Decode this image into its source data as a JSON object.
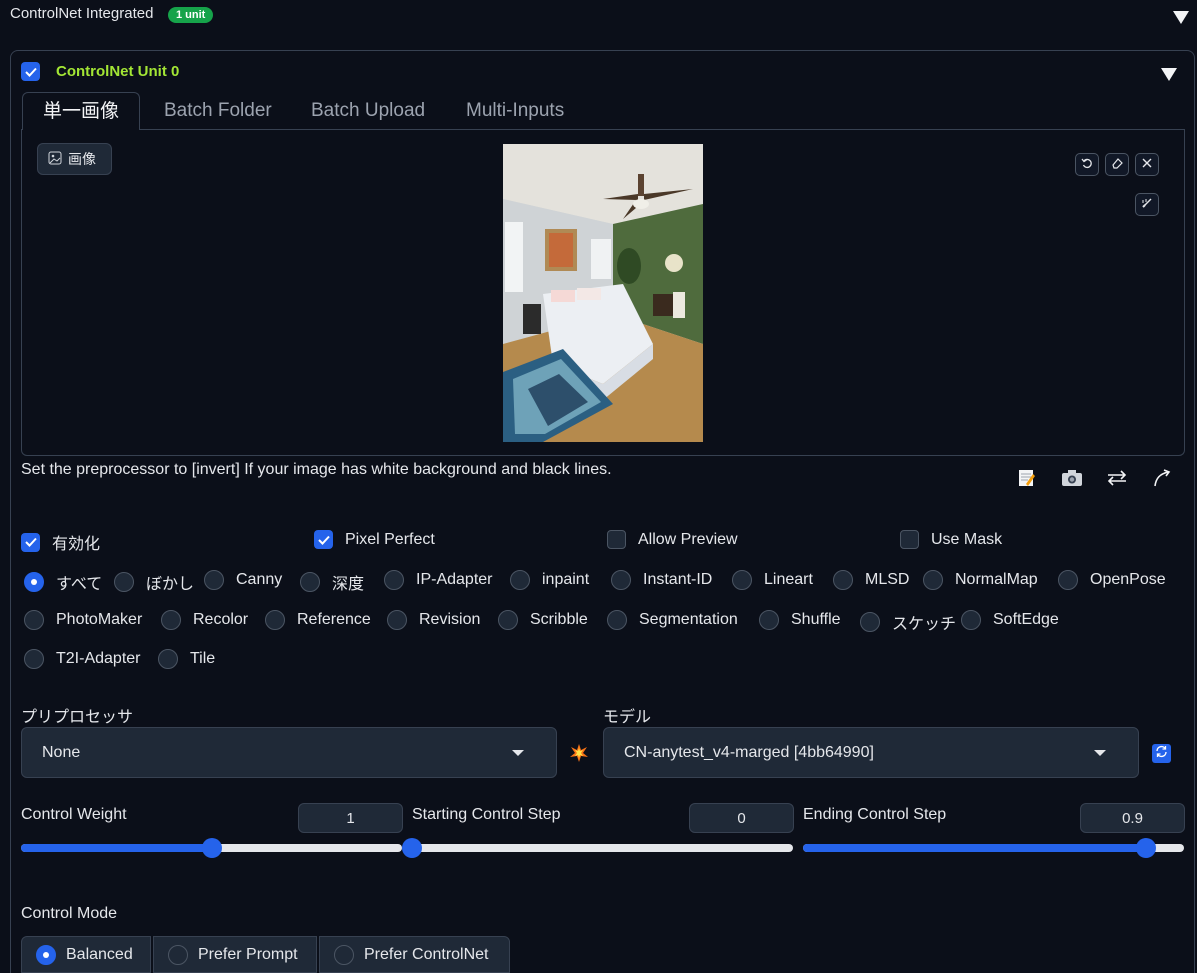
{
  "header": {
    "title": "ControlNet Integrated",
    "badge": "1 unit"
  },
  "unit": {
    "title": "ControlNet Unit 0",
    "enabled": true
  },
  "tabs": [
    {
      "label": "単一画像",
      "active": true
    },
    {
      "label": "Batch Folder",
      "active": false
    },
    {
      "label": "Batch Upload",
      "active": false
    },
    {
      "label": "Multi-Inputs",
      "active": false
    }
  ],
  "image_panel": {
    "label": "画像",
    "tools": [
      "undo-icon",
      "eraser-icon",
      "close-icon",
      "brush-icon"
    ]
  },
  "hint": "Set the preprocessor to [invert] If your image has white background and black lines.",
  "action_icons": [
    "notepad-icon",
    "camera-icon",
    "swap-icon",
    "send-arrow-icon"
  ],
  "options": {
    "enable": {
      "label": "有効化",
      "checked": true
    },
    "pixel_perfect": {
      "label": "Pixel Perfect",
      "checked": true
    },
    "allow_preview": {
      "label": "Allow Preview",
      "checked": false
    },
    "use_mask": {
      "label": "Use Mask",
      "checked": false
    }
  },
  "control_types": {
    "selected": "すべて",
    "items": [
      "すべて",
      "ぼかし",
      "Canny",
      "深度",
      "IP-Adapter",
      "inpaint",
      "Instant-ID",
      "Lineart",
      "MLSD",
      "NormalMap",
      "OpenPose",
      "PhotoMaker",
      "Recolor",
      "Reference",
      "Revision",
      "Scribble",
      "Segmentation",
      "Shuffle",
      "スケッチ",
      "SoftEdge",
      "T2I-Adapter",
      "Tile"
    ]
  },
  "preprocessor": {
    "label": "プリプロセッサ",
    "value": "None"
  },
  "model": {
    "label": "モデル",
    "value": "CN-anytest_v4-marged [4bb64990]"
  },
  "sliders": {
    "control_weight": {
      "label": "Control Weight",
      "value": "1",
      "fraction": 0.5
    },
    "starting_step": {
      "label": "Starting Control Step",
      "value": "0",
      "fraction": 0.0
    },
    "ending_step": {
      "label": "Ending Control Step",
      "value": "0.9",
      "fraction": 0.9
    }
  },
  "control_mode": {
    "label": "Control Mode",
    "selected": "Balanced",
    "options": [
      "Balanced",
      "Prefer Prompt",
      "Prefer ControlNet"
    ]
  },
  "colors": {
    "accent": "#2563eb",
    "badge": "#16a34a",
    "unit_title": "#a3e635",
    "background": "#0b0f19"
  }
}
